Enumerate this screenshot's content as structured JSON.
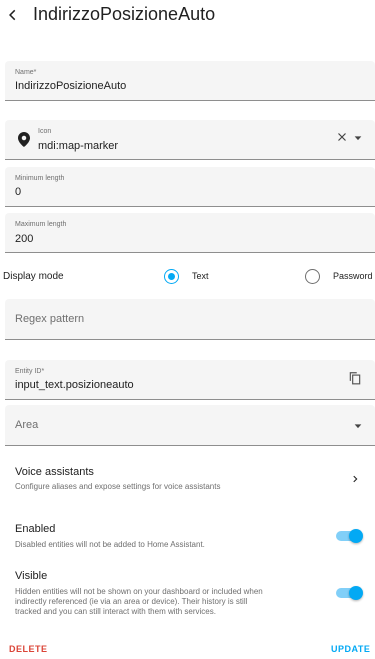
{
  "header": {
    "title": "IndirizzoPosizioneAuto"
  },
  "name_field": {
    "label": "Name*",
    "value": "IndirizzoPosizioneAuto"
  },
  "icon_field": {
    "label": "Icon",
    "value": "mdi:map-marker",
    "icon": "map-marker-icon"
  },
  "min_length_field": {
    "label": "Minimum length",
    "value": "0"
  },
  "max_length_field": {
    "label": "Maximum length",
    "value": "200"
  },
  "display_mode": {
    "label": "Display mode",
    "options": [
      {
        "label": "Text",
        "selected": true
      },
      {
        "label": "Password",
        "selected": false
      }
    ]
  },
  "regex_field": {
    "placeholder": "Regex pattern"
  },
  "entity_id_field": {
    "label": "Entity ID*",
    "value": "input_text.posizioneauto"
  },
  "area_field": {
    "placeholder": "Area"
  },
  "voice_assistants": {
    "title": "Voice assistants",
    "description": "Configure aliases and expose settings for voice assistants"
  },
  "enabled": {
    "title": "Enabled",
    "description": "Disabled entities will not be added to Home Assistant.",
    "on": true
  },
  "visible": {
    "title": "Visible",
    "description_lines": [
      "Hidden entities will not be shown on your dashboard or included when",
      "indirectly referenced (ie via an area or device). Their history is still",
      "tracked and you can still interact with them with services."
    ],
    "on": true
  },
  "actions": {
    "delete_label": "DELETE",
    "update_label": "UPDATE"
  },
  "colors": {
    "accent": "#03a9f4",
    "danger": "#db4437",
    "field_bg": "#f5f5f5"
  }
}
